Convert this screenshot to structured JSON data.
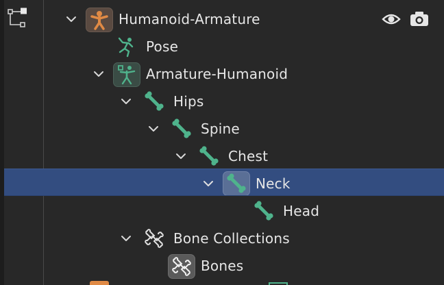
{
  "outliner": {
    "rows": [
      {
        "label": "Humanoid-Armature",
        "icon": "armature-object-icon",
        "expanded": true
      },
      {
        "label": "Pose",
        "icon": "pose-icon"
      },
      {
        "label": "Armature-Humanoid",
        "icon": "armature-data-icon",
        "expanded": true
      },
      {
        "label": "Hips",
        "icon": "bone-icon",
        "expanded": true
      },
      {
        "label": "Spine",
        "icon": "bone-icon",
        "expanded": true
      },
      {
        "label": "Chest",
        "icon": "bone-icon",
        "expanded": true
      },
      {
        "label": "Neck",
        "icon": "bone-icon",
        "expanded": true,
        "selected": true
      },
      {
        "label": "Head",
        "icon": "bone-icon"
      },
      {
        "label": "Bone Collections",
        "icon": "bone-collection-icon",
        "expanded": true
      },
      {
        "label": "Bones",
        "icon": "bone-collection-icon"
      }
    ],
    "right_icons": [
      "eye-icon",
      "camera-icon"
    ]
  },
  "colors": {
    "background": "#282828",
    "selected_row": "#334d80",
    "bone_green": "#4fb38c",
    "armature_orange": "#e08a45"
  }
}
